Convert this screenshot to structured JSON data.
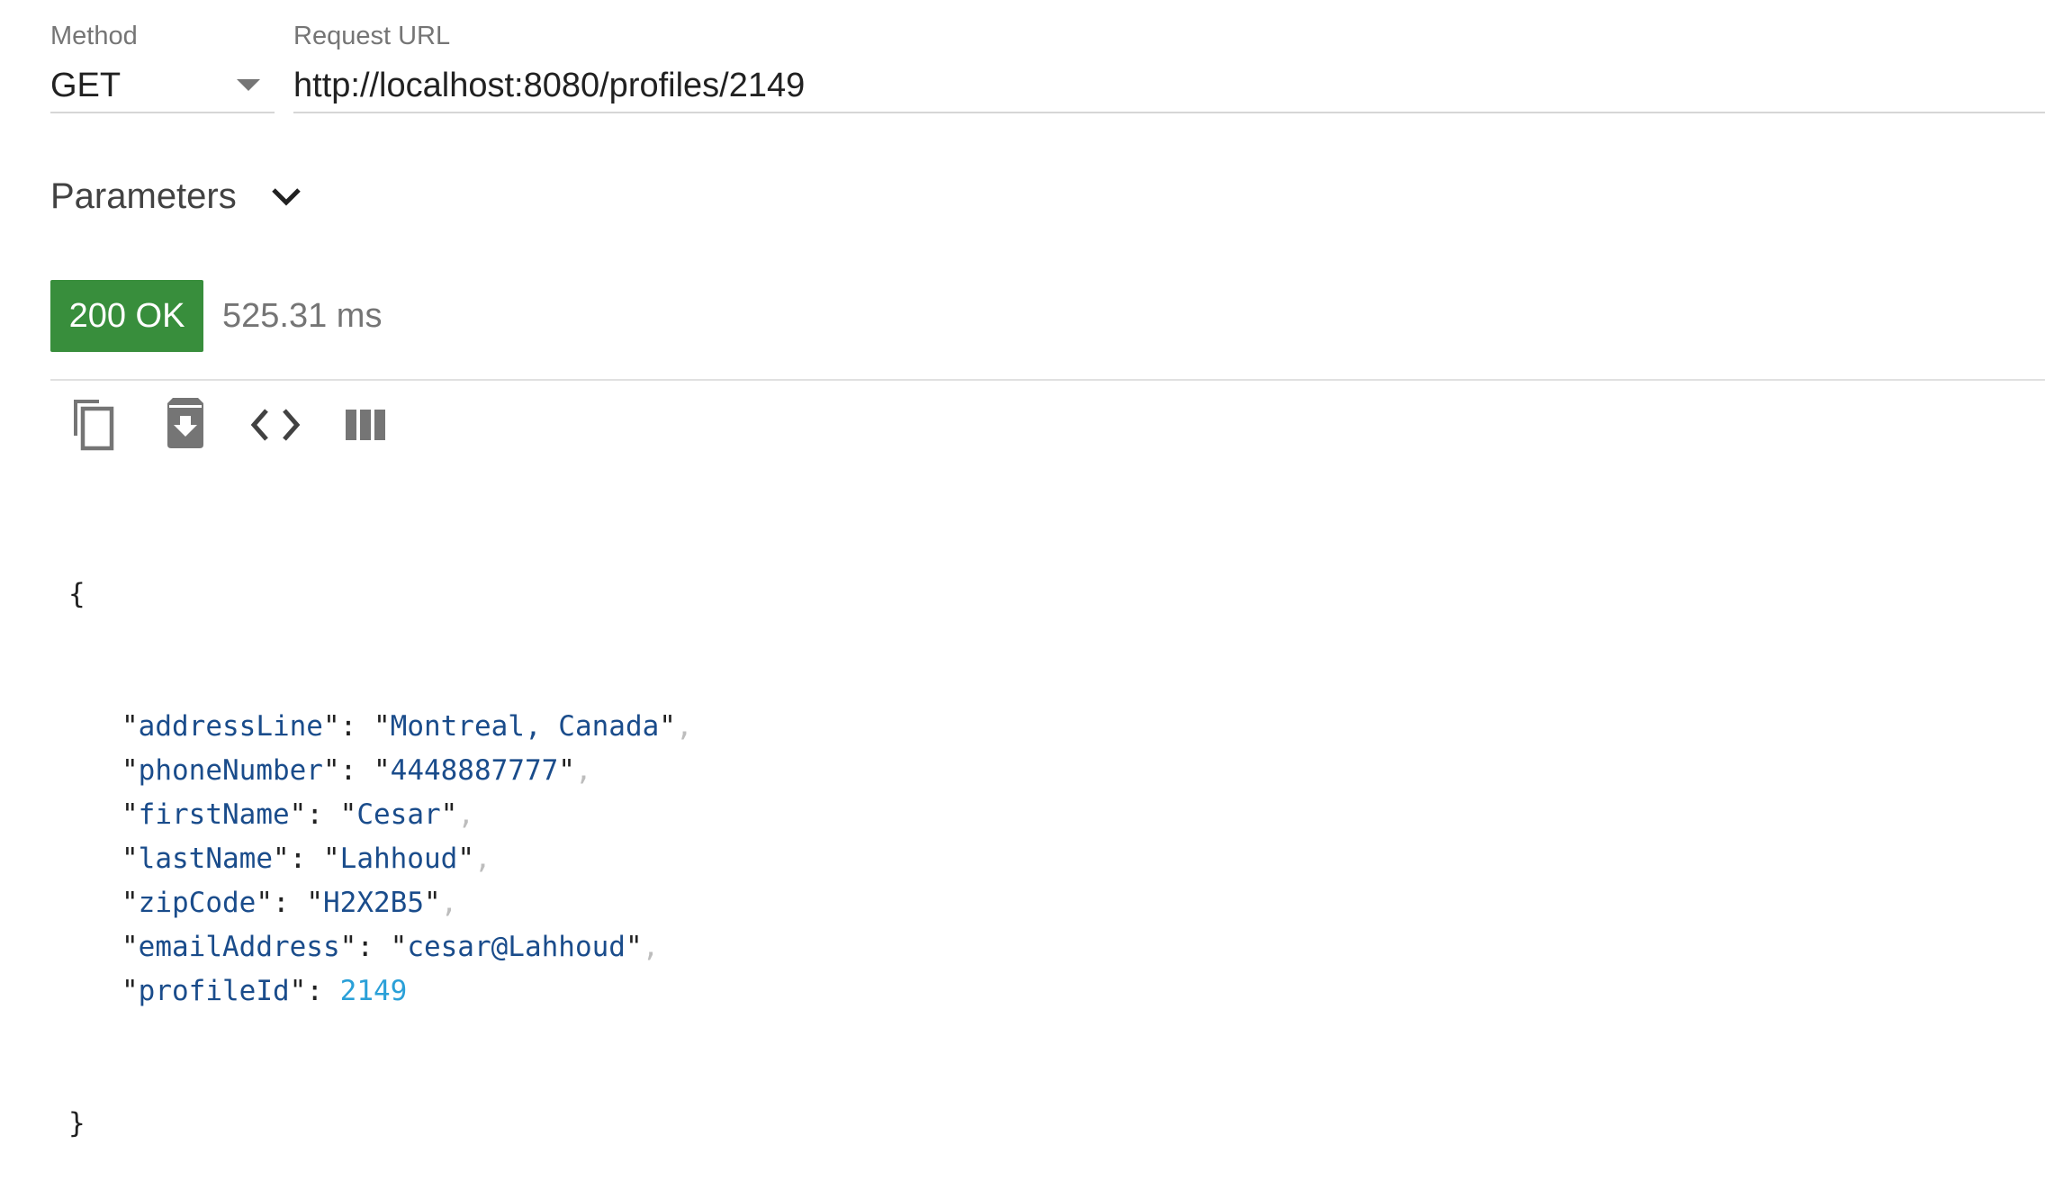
{
  "request": {
    "method_label": "Method",
    "method_value": "GET",
    "url_label": "Request URL",
    "url_value": "http://localhost:8080/profiles/2149"
  },
  "parameters": {
    "label": "Parameters"
  },
  "response": {
    "status": "200 OK",
    "status_color": "#388e3c",
    "time": "525.31 ms"
  },
  "toolbar": {
    "icons": [
      "copy-icon",
      "download-archive-icon",
      "code-icon",
      "columns-icon"
    ]
  },
  "json": {
    "open_brace": "{",
    "close_brace": "}",
    "entries": [
      {
        "key": "addressLine",
        "value": "Montreal, Canada",
        "type": "string"
      },
      {
        "key": "phoneNumber",
        "value": "4448887777",
        "type": "string"
      },
      {
        "key": "firstName",
        "value": "Cesar",
        "type": "string"
      },
      {
        "key": "lastName",
        "value": "Lahhoud",
        "type": "string"
      },
      {
        "key": "zipCode",
        "value": "H2X2B5",
        "type": "string"
      },
      {
        "key": "emailAddress",
        "value": "cesar@Lahhoud",
        "type": "string"
      },
      {
        "key": "profileId",
        "value": "2149",
        "type": "number"
      }
    ]
  }
}
